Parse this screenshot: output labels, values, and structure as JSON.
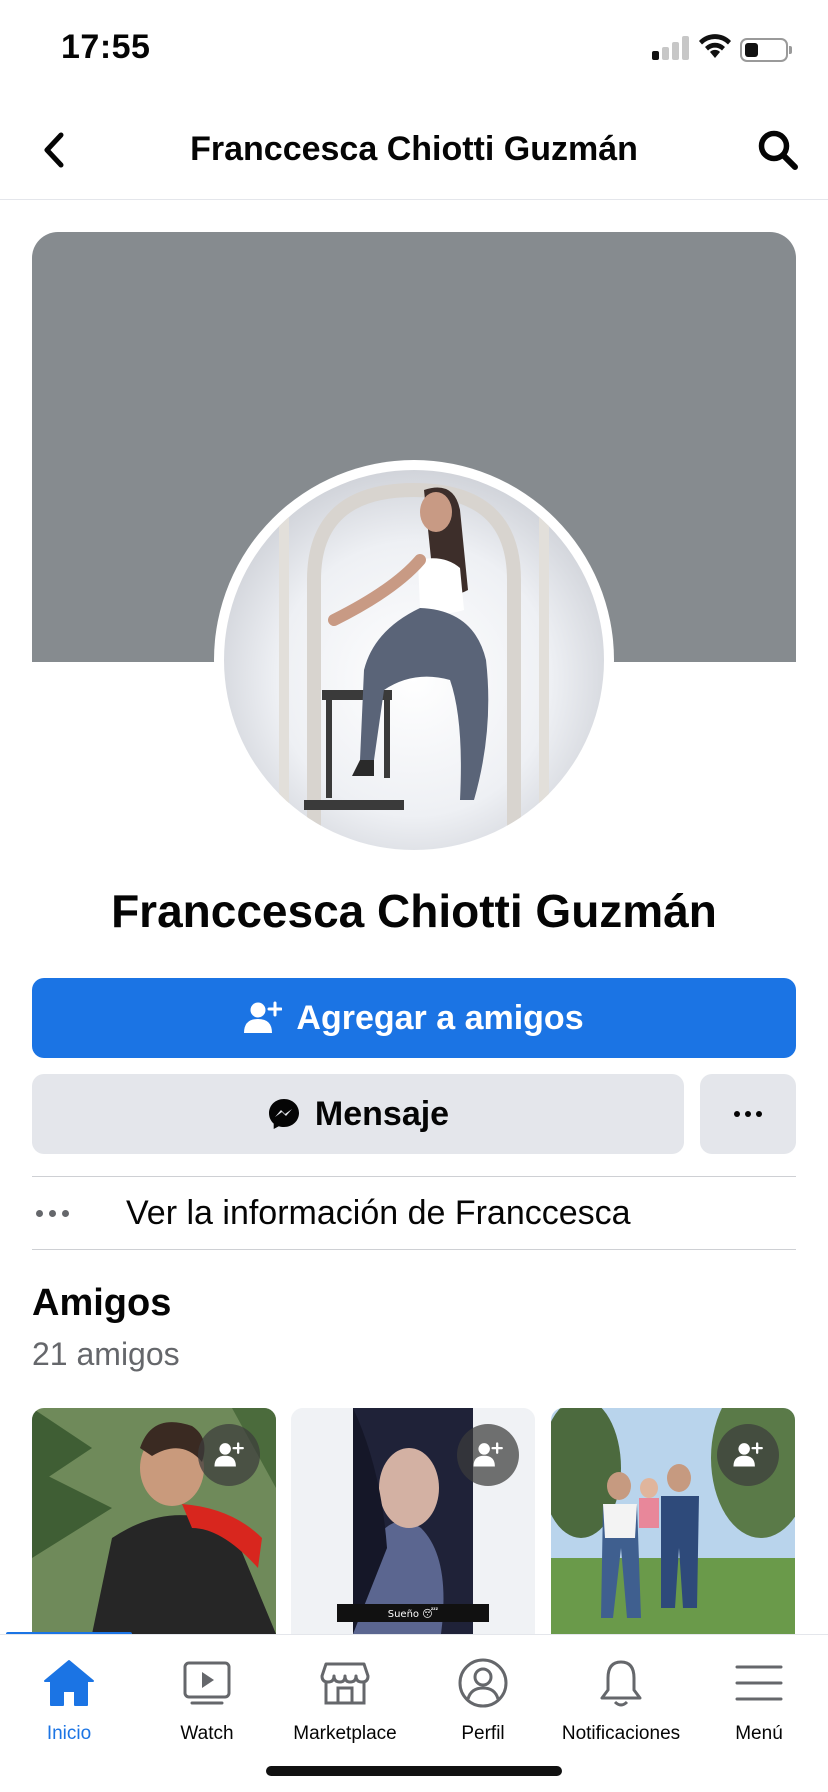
{
  "status_bar": {
    "time": "17:55"
  },
  "header": {
    "title": "Franccesca Chiotti Guzmán"
  },
  "profile": {
    "name": "Franccesca Chiotti Guzmán",
    "add_friend_label": "Agregar a amigos",
    "message_label": "Mensaje",
    "info_label": "Ver la información de Franccesca"
  },
  "friends": {
    "title": "Amigos",
    "count_label": "21 amigos",
    "cards": [
      {
        "photo": "man-in-red-jacket-photo"
      },
      {
        "photo": "woman-selfie-photo",
        "caption": "Sueño 😴"
      },
      {
        "photo": "family-in-park-photo"
      }
    ]
  },
  "tab_bar": {
    "items": [
      {
        "label": "Inicio",
        "icon": "home-icon",
        "active": true
      },
      {
        "label": "Watch",
        "icon": "watch-icon"
      },
      {
        "label": "Marketplace",
        "icon": "marketplace-icon"
      },
      {
        "label": "Perfil",
        "icon": "profile-icon"
      },
      {
        "label": "Notificaciones",
        "icon": "bell-icon"
      },
      {
        "label": "Menú",
        "icon": "menu-icon"
      }
    ]
  },
  "colors": {
    "accent": "#1b74e4",
    "cover": "#868b8f",
    "secondary_button": "#e4e6eb",
    "secondary_text": "#65676b"
  }
}
